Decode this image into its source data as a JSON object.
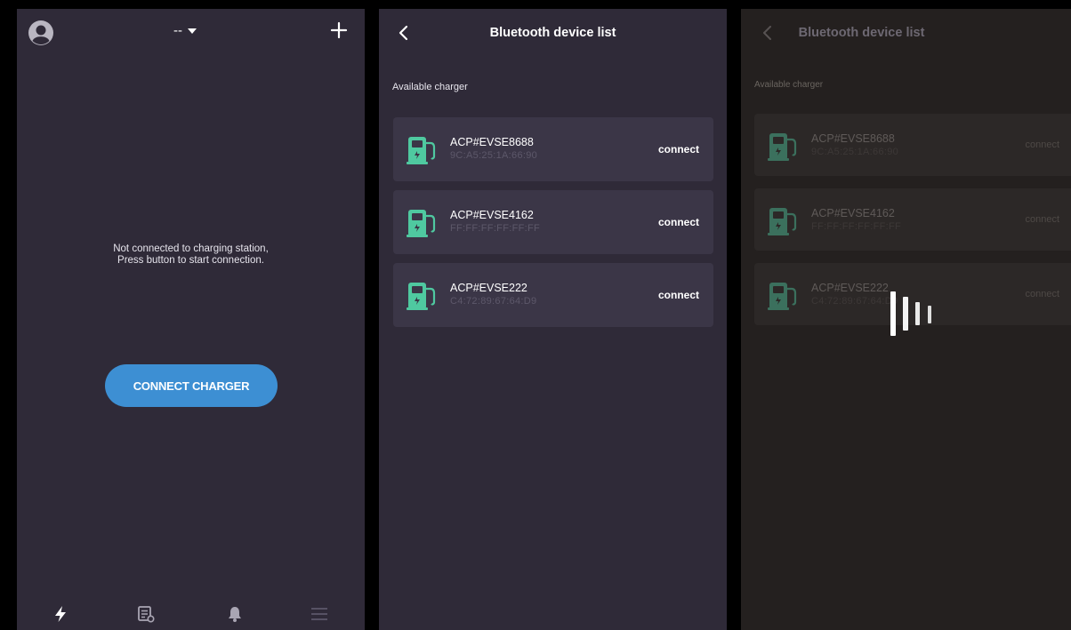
{
  "screen1": {
    "selector_value": "--",
    "message_line1": "Not connected to charging station,",
    "message_line2": "Press button to start connection.",
    "connect_button_label": "CONNECT CHARGER",
    "nav_icons": [
      "lightning-icon",
      "records-icon",
      "bell-icon",
      "menu-icon"
    ]
  },
  "screen2": {
    "title": "Bluetooth device list",
    "section_label": "Available charger",
    "devices": [
      {
        "name": "ACP#EVSE8688",
        "mac": "9C:A5:25:1A:66:90",
        "action": "connect"
      },
      {
        "name": "ACP#EVSE4162",
        "mac": "FF:FF:FF:FF:FF:FF",
        "action": "connect"
      },
      {
        "name": "ACP#EVSE222",
        "mac": "C4:72:89:67:64:D9",
        "action": "connect"
      }
    ]
  },
  "screen3": {
    "title": "Bluetooth device list",
    "section_label": "Available charger",
    "devices": [
      {
        "name": "ACP#EVSE8688",
        "mac": "9C:A5:25:1A:66:90",
        "action": "connect"
      },
      {
        "name": "ACP#EVSE4162",
        "mac": "FF:FF:FF:FF:FF:FF",
        "action": "connect"
      },
      {
        "name": "ACP#EVSE222",
        "mac": "C4:72:89:67:64:D9",
        "action": "connect"
      }
    ]
  },
  "colors": {
    "panel_bg": "#2f2a38",
    "card_bg": "#3b3647",
    "accent_blue": "#3d8fd3",
    "charger_green": "#4fc9a0",
    "dimmed_bg": "#24201f"
  }
}
